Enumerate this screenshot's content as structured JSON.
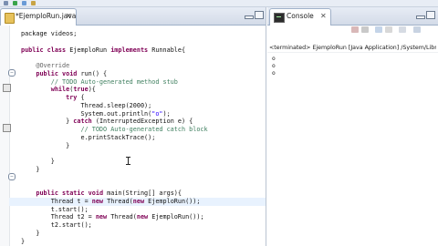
{
  "toolbar": {
    "icons": [
      "save-icon",
      "run-icon",
      "debug-icon",
      "search-icon",
      "back-icon",
      "forward-icon"
    ]
  },
  "editor": {
    "tab_label": "*EjemploRun.java",
    "tab_close": "✕",
    "lines": [
      [
        {
          "t": "package videos;",
          "c": "kw-first"
        }
      ],
      [
        {
          "t": "",
          "c": ""
        }
      ],
      [
        {
          "t": "public class",
          "c": "kw"
        },
        {
          "t": " EjemploRun ",
          "c": ""
        },
        {
          "t": "implements",
          "c": "kw"
        },
        {
          "t": " Runnable{",
          "c": ""
        }
      ],
      [
        {
          "t": "",
          "c": ""
        }
      ],
      [
        {
          "t": "    @Override",
          "c": "an"
        }
      ],
      [
        {
          "t": "    ",
          "c": ""
        },
        {
          "t": "public void",
          "c": "kw"
        },
        {
          "t": " run() {",
          "c": ""
        }
      ],
      [
        {
          "t": "        // TODO Auto-generated method stub",
          "c": "cm"
        }
      ],
      [
        {
          "t": "        ",
          "c": ""
        },
        {
          "t": "while",
          "c": "kw"
        },
        {
          "t": "(",
          "c": ""
        },
        {
          "t": "true",
          "c": "kw"
        },
        {
          "t": "){",
          "c": ""
        }
      ],
      [
        {
          "t": "            ",
          "c": ""
        },
        {
          "t": "try",
          "c": "kw"
        },
        {
          "t": " {",
          "c": ""
        }
      ],
      [
        {
          "t": "                Thread.sleep(2000);",
          "c": ""
        }
      ],
      [
        {
          "t": "                System.out.println(",
          "c": ""
        },
        {
          "t": "\"o\"",
          "c": "st"
        },
        {
          "t": ");",
          "c": ""
        }
      ],
      [
        {
          "t": "            } ",
          "c": ""
        },
        {
          "t": "catch",
          "c": "kw"
        },
        {
          "t": " (InterruptedException e) {",
          "c": ""
        }
      ],
      [
        {
          "t": "                // TODO Auto-generated catch block",
          "c": "cm"
        }
      ],
      [
        {
          "t": "                e.printStackTrace();",
          "c": ""
        }
      ],
      [
        {
          "t": "            }",
          "c": ""
        }
      ],
      [
        {
          "t": "",
          "c": ""
        }
      ],
      [
        {
          "t": "        }",
          "c": ""
        }
      ],
      [
        {
          "t": "    }",
          "c": ""
        }
      ],
      [
        {
          "t": "",
          "c": ""
        }
      ],
      [
        {
          "t": "",
          "c": ""
        }
      ],
      [
        {
          "t": "    ",
          "c": ""
        },
        {
          "t": "public static void",
          "c": "kw"
        },
        {
          "t": " main(String[] args){",
          "c": ""
        }
      ],
      [
        {
          "t": "        Thread t = ",
          "c": ""
        },
        {
          "t": "new",
          "c": "kw"
        },
        {
          "t": " Thread(",
          "c": ""
        },
        {
          "t": "new",
          "c": "kw"
        },
        {
          "t": " EjemploRun());",
          "c": ""
        }
      ],
      [
        {
          "t": "        t.start();",
          "c": ""
        }
      ],
      [
        {
          "t": "        Thread t2 = ",
          "c": ""
        },
        {
          "t": "new",
          "c": "kw"
        },
        {
          "t": " Thread(",
          "c": ""
        },
        {
          "t": "new",
          "c": "kw"
        },
        {
          "t": " EjemploRun());",
          "c": ""
        }
      ],
      [
        {
          "t": "        t2.start();",
          "c": ""
        }
      ],
      [
        {
          "t": "    }",
          "c": ""
        }
      ],
      [
        {
          "t": "}",
          "c": ""
        }
      ]
    ]
  },
  "console": {
    "tab_label": "Console",
    "tab_close": "✕",
    "status": "<terminated> EjemploRun [Java Application] /System/Library/Ja",
    "output_lines": [
      "o",
      "o",
      "o"
    ]
  },
  "colors": {
    "keyword": "#7f0055",
    "comment": "#3f7f5f",
    "string": "#2a00ff",
    "annotation": "#646464",
    "current_line": "#e8f2fe"
  }
}
